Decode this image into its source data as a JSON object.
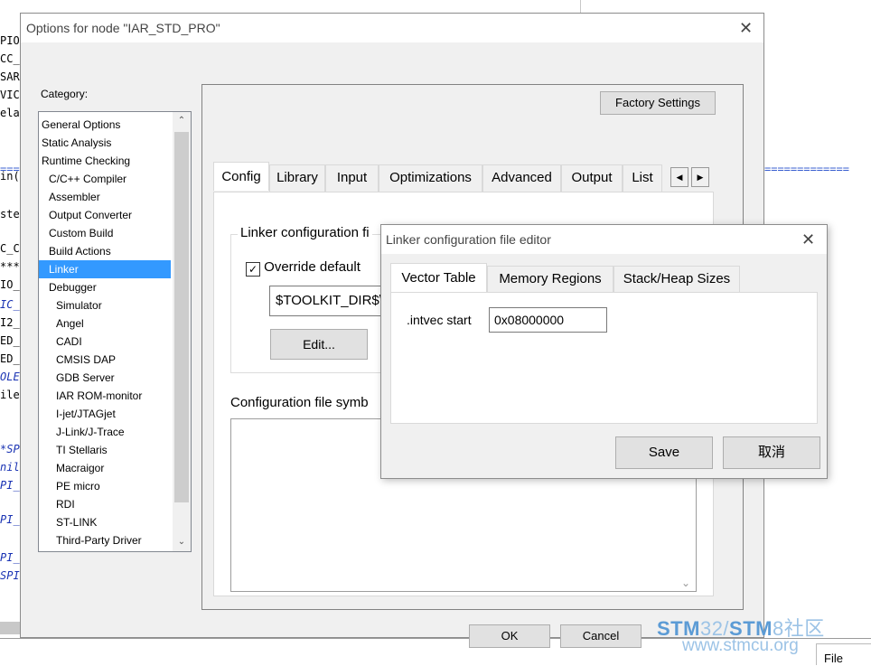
{
  "background_editor": {
    "code_fragments": [
      "PIO",
      "CC_",
      "SAR",
      "VIC",
      "ela",
      "in(",
      "ste",
      "C_C",
      "***",
      "IO_",
      "IC_",
      "I2_",
      "ED_",
      "ED_",
      "OLE",
      "ile",
      "*SP",
      "nil",
      "PI_",
      "PI_",
      "PI_",
      "SPI"
    ],
    "separator": "====",
    "separator_right": "=============",
    "status_text": "File"
  },
  "options_dialog": {
    "title": "Options for node \"IAR_STD_PRO\"",
    "category_label": "Category:",
    "categories": [
      {
        "label": "General Options",
        "indent": 0
      },
      {
        "label": "Static Analysis",
        "indent": 0
      },
      {
        "label": "Runtime Checking",
        "indent": 0
      },
      {
        "label": "C/C++ Compiler",
        "indent": 1
      },
      {
        "label": "Assembler",
        "indent": 1
      },
      {
        "label": "Output Converter",
        "indent": 1
      },
      {
        "label": "Custom Build",
        "indent": 1
      },
      {
        "label": "Build Actions",
        "indent": 1
      },
      {
        "label": "Linker",
        "indent": 1,
        "selected": true
      },
      {
        "label": "Debugger",
        "indent": 1
      },
      {
        "label": "Simulator",
        "indent": 2
      },
      {
        "label": "Angel",
        "indent": 2
      },
      {
        "label": "CADI",
        "indent": 2
      },
      {
        "label": "CMSIS DAP",
        "indent": 2
      },
      {
        "label": "GDB Server",
        "indent": 2
      },
      {
        "label": "IAR ROM-monitor",
        "indent": 2
      },
      {
        "label": "I-jet/JTAGjet",
        "indent": 2
      },
      {
        "label": "J-Link/J-Trace",
        "indent": 2
      },
      {
        "label": "TI Stellaris",
        "indent": 2
      },
      {
        "label": "Macraigor",
        "indent": 2
      },
      {
        "label": "PE micro",
        "indent": 2
      },
      {
        "label": "RDI",
        "indent": 2
      },
      {
        "label": "ST-LINK",
        "indent": 2
      },
      {
        "label": "Third-Party Driver",
        "indent": 2
      }
    ],
    "factory_settings_label": "Factory Settings",
    "tabs": [
      "Config",
      "Library",
      "Input",
      "Optimizations",
      "Advanced",
      "Output",
      "List"
    ],
    "active_tab": "Config",
    "linker_config_group": "Linker configuration fi",
    "override_default_label": "Override default",
    "override_checked": true,
    "config_path": "$TOOLKIT_DIR$\\",
    "edit_button": "Edit...",
    "config_symbols_label": "Configuration file symb",
    "ok_label": "OK",
    "cancel_label": "Cancel"
  },
  "linker_editor": {
    "title": "Linker configuration file editor",
    "tabs": [
      "Vector Table",
      "Memory Regions",
      "Stack/Heap Sizes"
    ],
    "active_tab": "Vector Table",
    "intvec_label": ".intvec start",
    "intvec_value": "0x08000000",
    "save_label": "Save",
    "cancel_label": "取消"
  },
  "watermark": {
    "title_a": "STM",
    "title_b": "32/",
    "title_c": "STM",
    "title_d": "8社区",
    "url": "www.stmcu.org"
  },
  "colors": {
    "selection": "#3399ff",
    "watermark_dark": "#5b9bd5",
    "watermark_light": "#9cc3e6"
  }
}
